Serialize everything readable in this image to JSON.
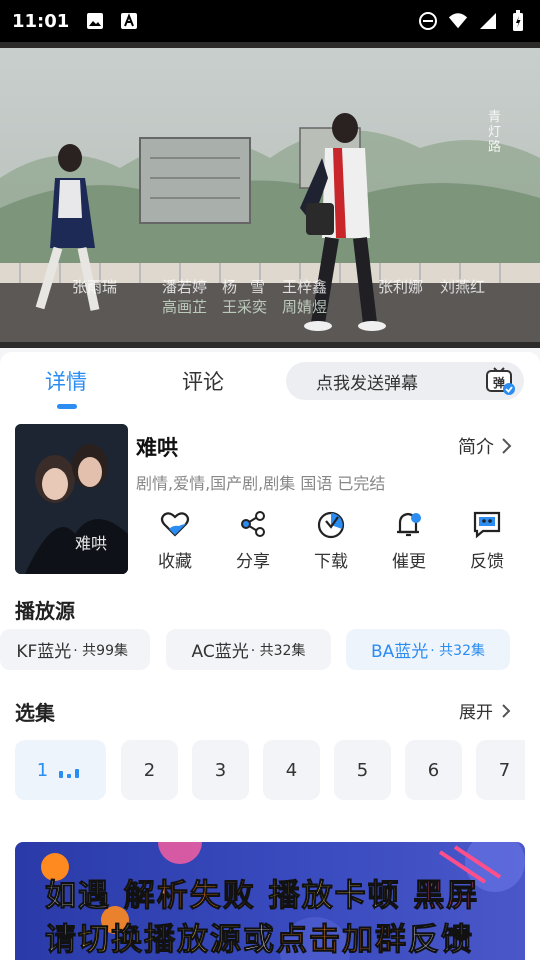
{
  "status_bar": {
    "time": "11:01",
    "icons": [
      "image-icon",
      "text-a-icon",
      "dnd-icon",
      "wifi-icon",
      "signal-icon",
      "battery-icon"
    ]
  },
  "video": {
    "credits_row1": [
      "张雨瑞",
      "潘若婷",
      "杨",
      "雪",
      "王梓鑫",
      "张利娜",
      "刘燕红"
    ],
    "credits_row2": [
      "高画芷",
      "王采奕",
      "周婧煜"
    ],
    "watermark": "青灯路"
  },
  "tabs": {
    "details": "详情",
    "comments": "评论"
  },
  "danmaku": {
    "placeholder": "点我发送弹幕",
    "icon_text": "弹"
  },
  "show": {
    "title": "难哄",
    "intro_label": "简介",
    "tags": "剧情,爱情,国产剧,剧集 国语 已完结"
  },
  "actions": [
    {
      "label": "收藏",
      "icon": "heart-icon"
    },
    {
      "label": "分享",
      "icon": "share-icon"
    },
    {
      "label": "下载",
      "icon": "download-icon"
    },
    {
      "label": "催更",
      "icon": "bell-icon"
    },
    {
      "label": "反馈",
      "icon": "feedback-icon"
    }
  ],
  "sources": {
    "title": "播放源",
    "items": [
      {
        "name": "KF蓝光",
        "count": "· 共99集"
      },
      {
        "name": "AC蓝光",
        "count": "· 共32集"
      },
      {
        "name": "BA蓝光",
        "count": "· 共32集",
        "active": true
      }
    ]
  },
  "episodes": {
    "title": "选集",
    "expand_label": "展开",
    "items": [
      "1",
      "2",
      "3",
      "4",
      "5",
      "6",
      "7"
    ]
  },
  "banner": {
    "line1": [
      "如遇",
      "解析失败",
      "播放卡顿",
      "黑屏"
    ],
    "line2": [
      "请",
      "切换播放源",
      "或",
      "点击加群",
      "反馈"
    ]
  },
  "colors": {
    "accent": "#2b8cf2",
    "banner_bg": "#3a4cc0",
    "banner_white": "#ffffff",
    "banner_orange": "#ff8a1f",
    "banner_yellow": "#ffd34a",
    "banner_pink": "#ff4f8a"
  }
}
